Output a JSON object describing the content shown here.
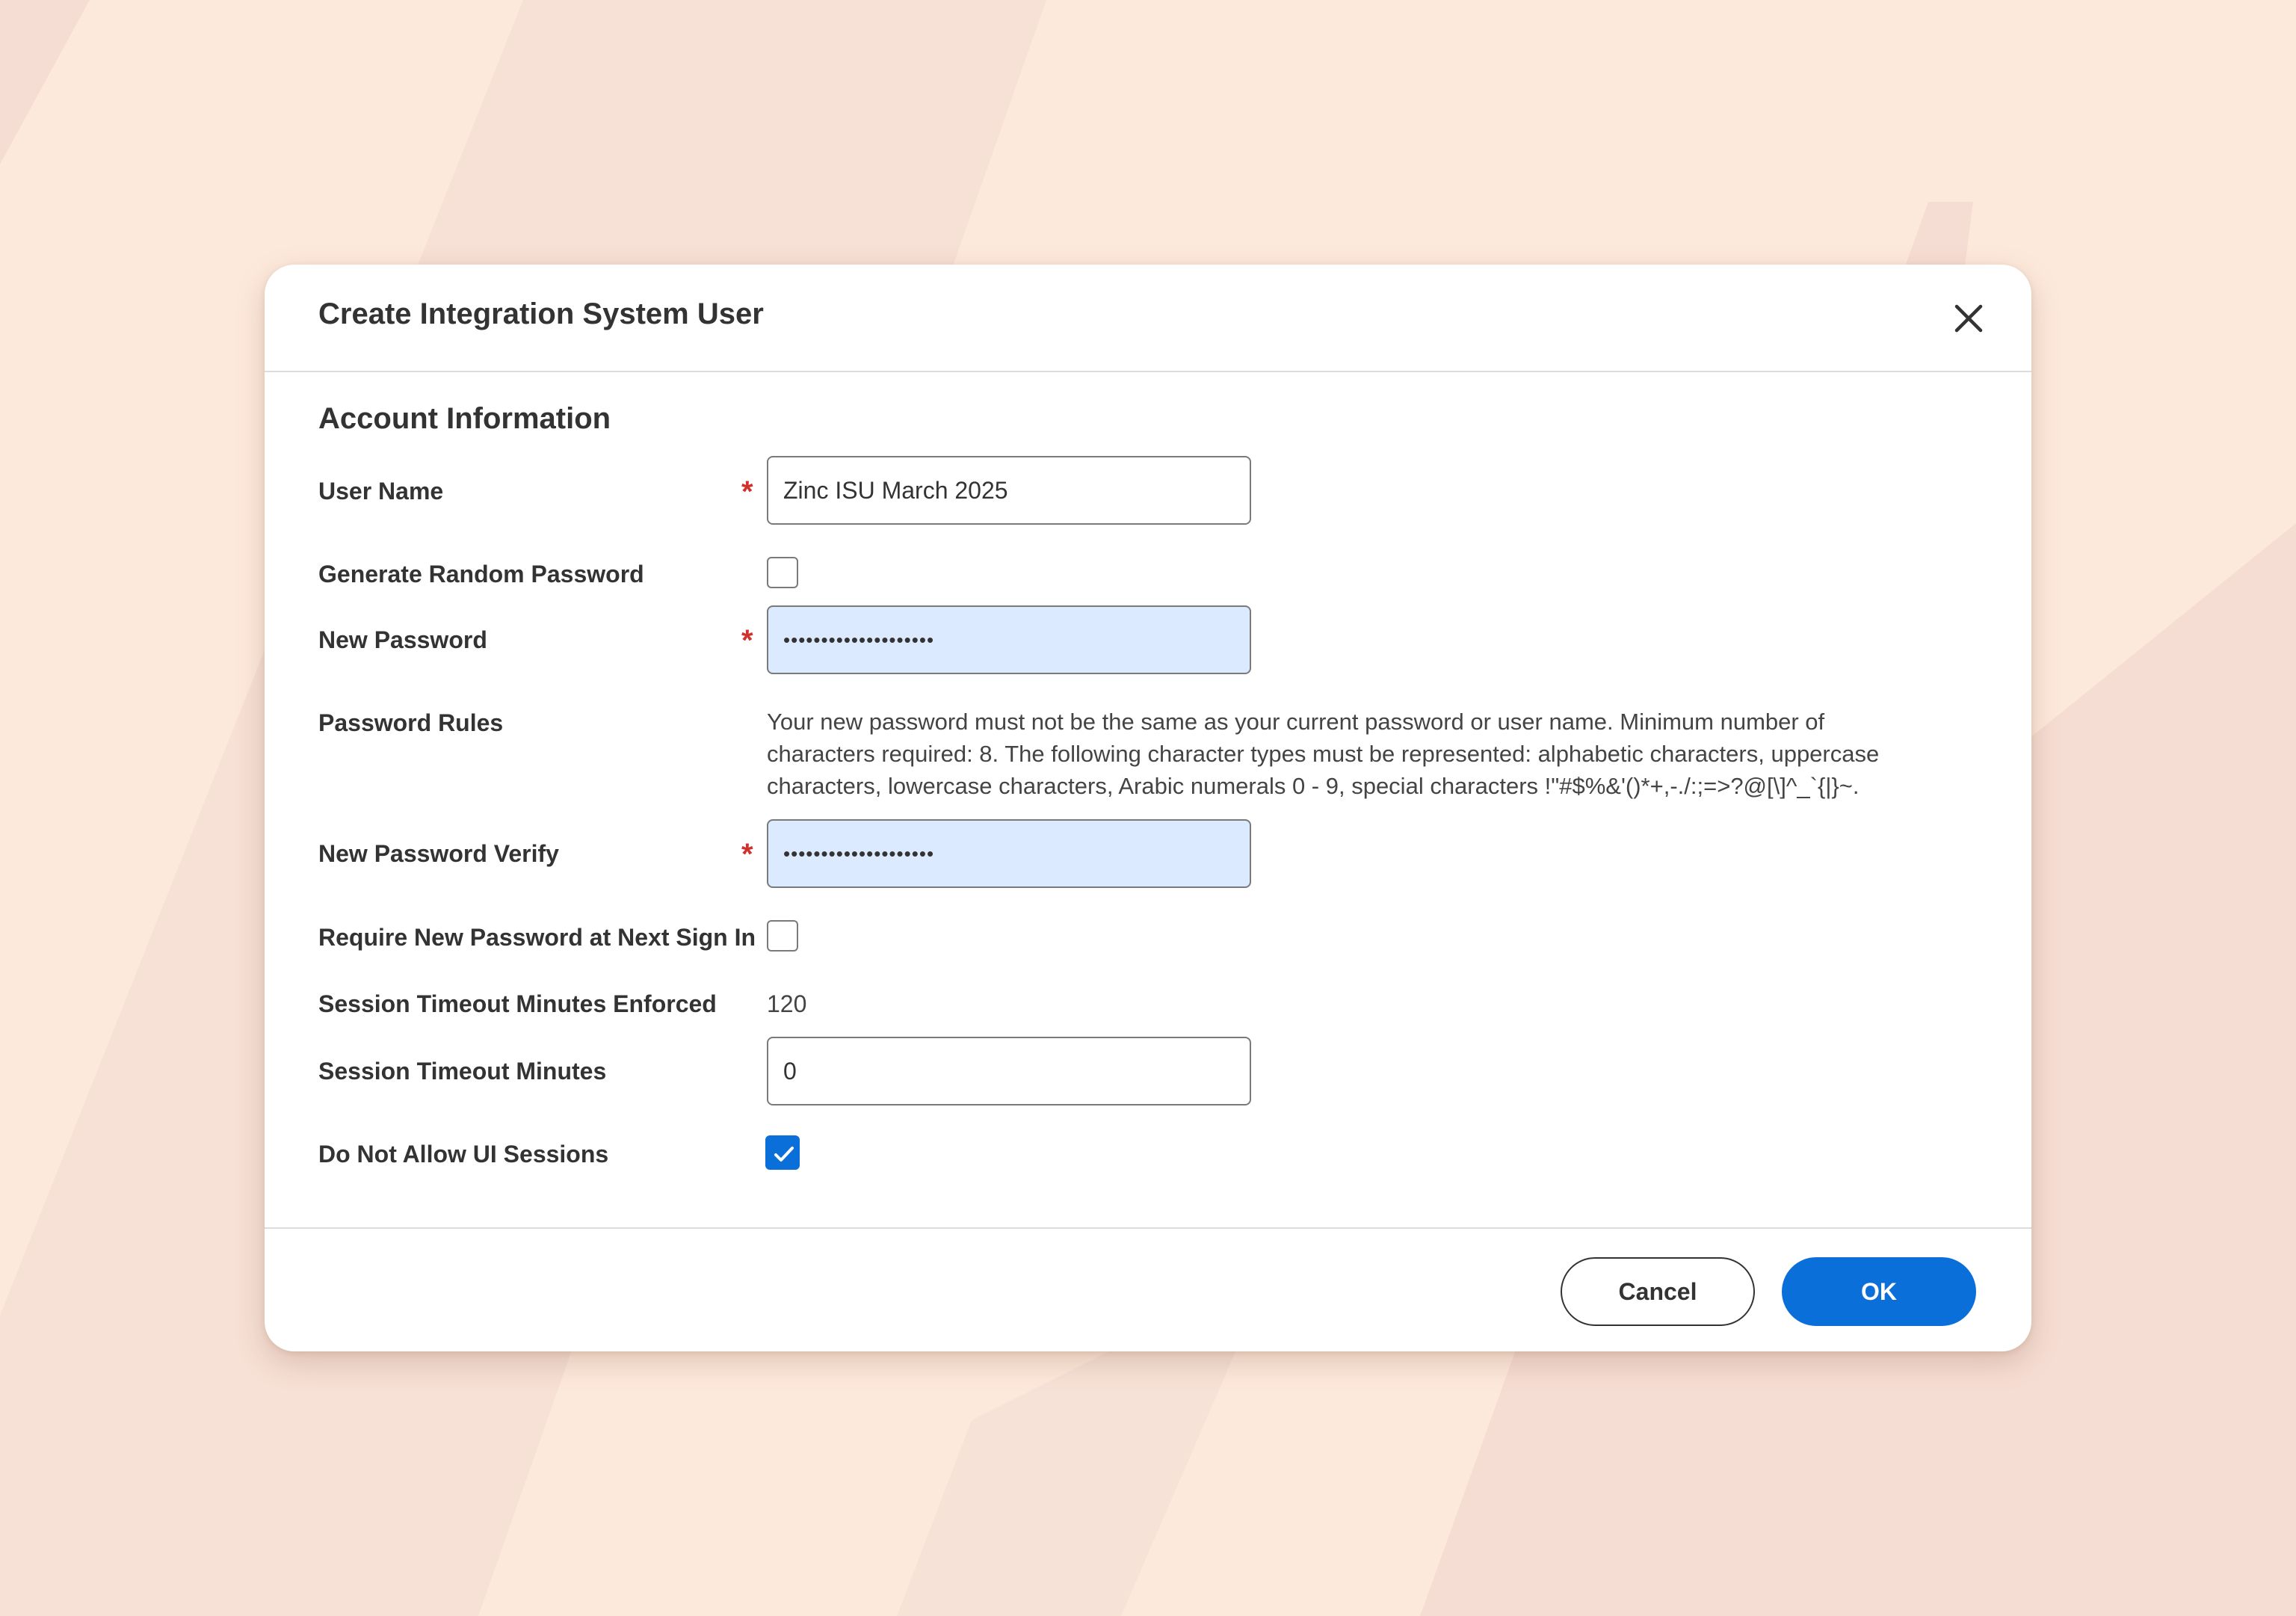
{
  "dialog": {
    "title": "Create Integration System User",
    "close_icon": "close-icon"
  },
  "section": {
    "title": "Account Information"
  },
  "fields": {
    "user_name": {
      "label": "User Name",
      "required": "*",
      "value": "Zinc ISU March 2025"
    },
    "generate_random_password": {
      "label": "Generate Random Password",
      "checked": false
    },
    "new_password": {
      "label": "New Password",
      "required": "*",
      "masked_value": "••••••••••••••••••••"
    },
    "password_rules": {
      "label": "Password Rules",
      "text": "Your new password must not be the same as your current password or user name. Minimum number of characters required: 8. The following character types must be represented: alphabetic characters, uppercase characters, lowercase characters, Arabic numerals 0 - 9, special characters !\"#$%&'()*+,-./:;=>?@[\\]^_`{|}~."
    },
    "new_password_verify": {
      "label": "New Password Verify",
      "required": "*",
      "masked_value": "••••••••••••••••••••"
    },
    "require_new_password": {
      "label": "Require New Password at Next Sign In",
      "checked": false
    },
    "session_timeout_enforced": {
      "label": "Session Timeout Minutes Enforced",
      "value": "120"
    },
    "session_timeout_minutes": {
      "label": "Session Timeout Minutes",
      "value": "0"
    },
    "do_not_allow_ui_sessions": {
      "label": "Do Not Allow UI Sessions",
      "checked": true
    }
  },
  "footer": {
    "cancel_label": "Cancel",
    "ok_label": "OK"
  },
  "colors": {
    "background": "#fde9dc",
    "accent": "#0b6fd9",
    "required": "#d0312d",
    "password_field_bg": "#dbeafe"
  }
}
